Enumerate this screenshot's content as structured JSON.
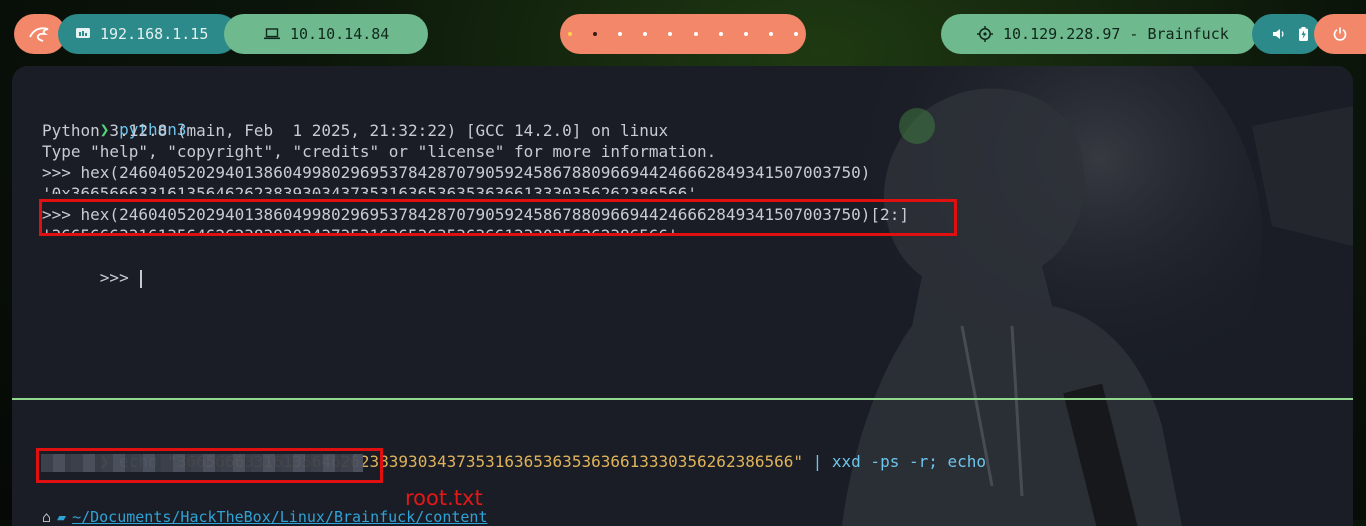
{
  "topbar": {
    "local_ip": "192.168.1.15",
    "vpn_ip": "10.10.14.84",
    "target": "10.129.228.97 - Brainfuck",
    "workspaces": 10
  },
  "terminal": {
    "pane1": {
      "cmd": "python3",
      "banner1": "Python 3.12.8 (main, Feb  1 2025, 21:32:22) [GCC 14.2.0] on linux",
      "banner2": "Type \"help\", \"copyright\", \"credits\" or \"license\" for more information.",
      "in1": ">>> hex(24604052029401386049980296953784287079059245867880966944246662849341507003750)",
      "out1": "'0x3665666331613564626238393034373531636536353636613330356262386566'",
      "in2": ">>> hex(24604052029401386049980296953784287079059245867880966944246662849341507003750)[2:]",
      "out2": "'3665666331613564626238393034373531636536353636613330356262386566'",
      "prompt": ">>> "
    },
    "pane2": {
      "echo": "echo ",
      "string": "\"3665666331613564626238393034373531636536353636613330356262386566\"",
      "rest": " | xxd -ps -r; echo",
      "path": "~/Documents/HackTheBox/Linux/Brainfuck/content"
    }
  },
  "annotation": "root.txt",
  "colors": {
    "accent_orange": "#f2876a",
    "accent_teal": "#2c8a8a",
    "accent_green": "#6fb98f",
    "highlight_red": "#e01010"
  },
  "icons": [
    "kali-dragon-icon",
    "network-icon",
    "laptop-icon",
    "target-icon",
    "volume-icon",
    "battery-icon",
    "power-icon",
    "prompt-arrow-icon",
    "home-icon",
    "folder-icon"
  ]
}
